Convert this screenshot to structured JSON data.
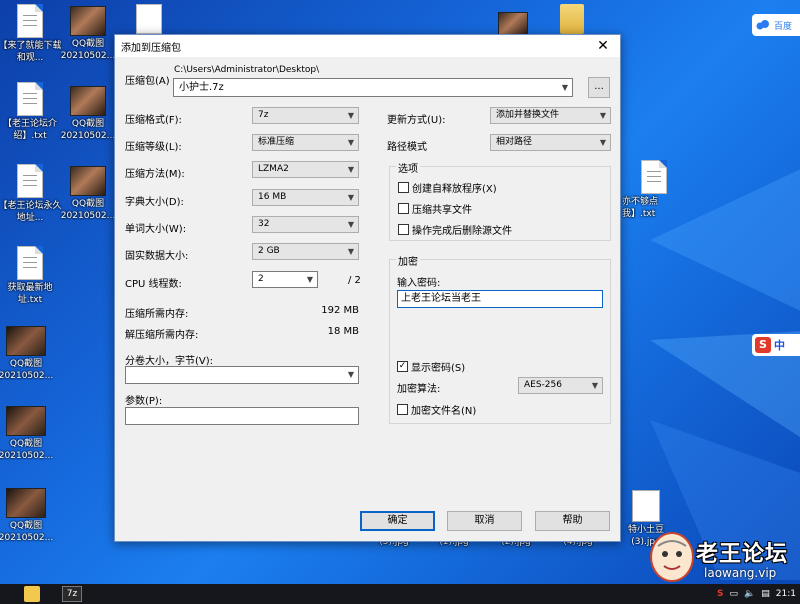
{
  "desktop": {
    "icons": [
      {
        "label": "【来了就能下载和观..."
      },
      {
        "label": "QQ截图20210502..."
      },
      {
        "label": "【老王论坛介绍】.txt"
      },
      {
        "label": "QQ截图20210502..."
      },
      {
        "label": "【老王论坛永久地址..."
      },
      {
        "label": "QQ截图20210502..."
      },
      {
        "label": "获取最新地址.txt"
      },
      {
        "label": "QQ截图20210502..."
      },
      {
        "label": "QQ截图20210502..."
      },
      {
        "label": "QQ截图20210502..."
      },
      {
        "label": "亦不够点我】.txt"
      },
      {
        "label": "(5).jpg"
      },
      {
        "label": "(1).jpg"
      },
      {
        "label": "(2).jpg"
      },
      {
        "label": "(4).jpg"
      },
      {
        "label": "特小土豆(3).jpg"
      }
    ],
    "baidu_label": "百度",
    "sogou_label": "中"
  },
  "dialog": {
    "title": "添加到压缩包",
    "archive_label": "压缩包(A)",
    "archive_path": "C:\\Users\\Administrator\\Desktop\\",
    "archive_name": "小护士.7z",
    "browse_label": "...",
    "left": {
      "format_label": "压缩格式(F):",
      "format_value": "7z",
      "level_label": "压缩等级(L):",
      "level_value": "标准压缩",
      "method_label": "压缩方法(M):",
      "method_value": "LZMA2",
      "dict_label": "字典大小(D):",
      "dict_value": "16 MB",
      "word_label": "单词大小(W):",
      "word_value": "32",
      "solid_label": "固实数据大小:",
      "solid_value": "2 GB",
      "cpu_label": "CPU 线程数:",
      "cpu_value": "2",
      "cpu_total": "/ 2",
      "mem_comp_label": "压缩所需内存:",
      "mem_comp_value": "192 MB",
      "mem_decomp_label": "解压缩所需内存:",
      "mem_decomp_value": "18 MB",
      "split_label": "分卷大小，字节(V):",
      "split_value": "",
      "params_label": "参数(P):",
      "params_value": ""
    },
    "right": {
      "update_label": "更新方式(U):",
      "update_value": "添加并替换文件",
      "path_label": "路径模式",
      "path_value": "相对路径",
      "options_title": "选项",
      "opt_sfx": "创建自释放程序(X)",
      "opt_shared": "压缩共享文件",
      "opt_delete": "操作完成后删除源文件",
      "encrypt_title": "加密",
      "password_label": "输入密码:",
      "password_value": "上老王论坛当老王",
      "show_password": "显示密码(S)",
      "show_password_mark": "✓",
      "enc_method_label": "加密算法:",
      "enc_method_value": "AES-256",
      "enc_names": "加密文件名(N)"
    },
    "buttons": {
      "ok": "确定",
      "cancel": "取消",
      "help": "帮助"
    }
  },
  "taskbar": {
    "clock": "21:1",
    "tray_input": "S",
    "active_app_label": "7z"
  },
  "watermark": {
    "title": "老王论坛",
    "url": "laowang.vip"
  }
}
